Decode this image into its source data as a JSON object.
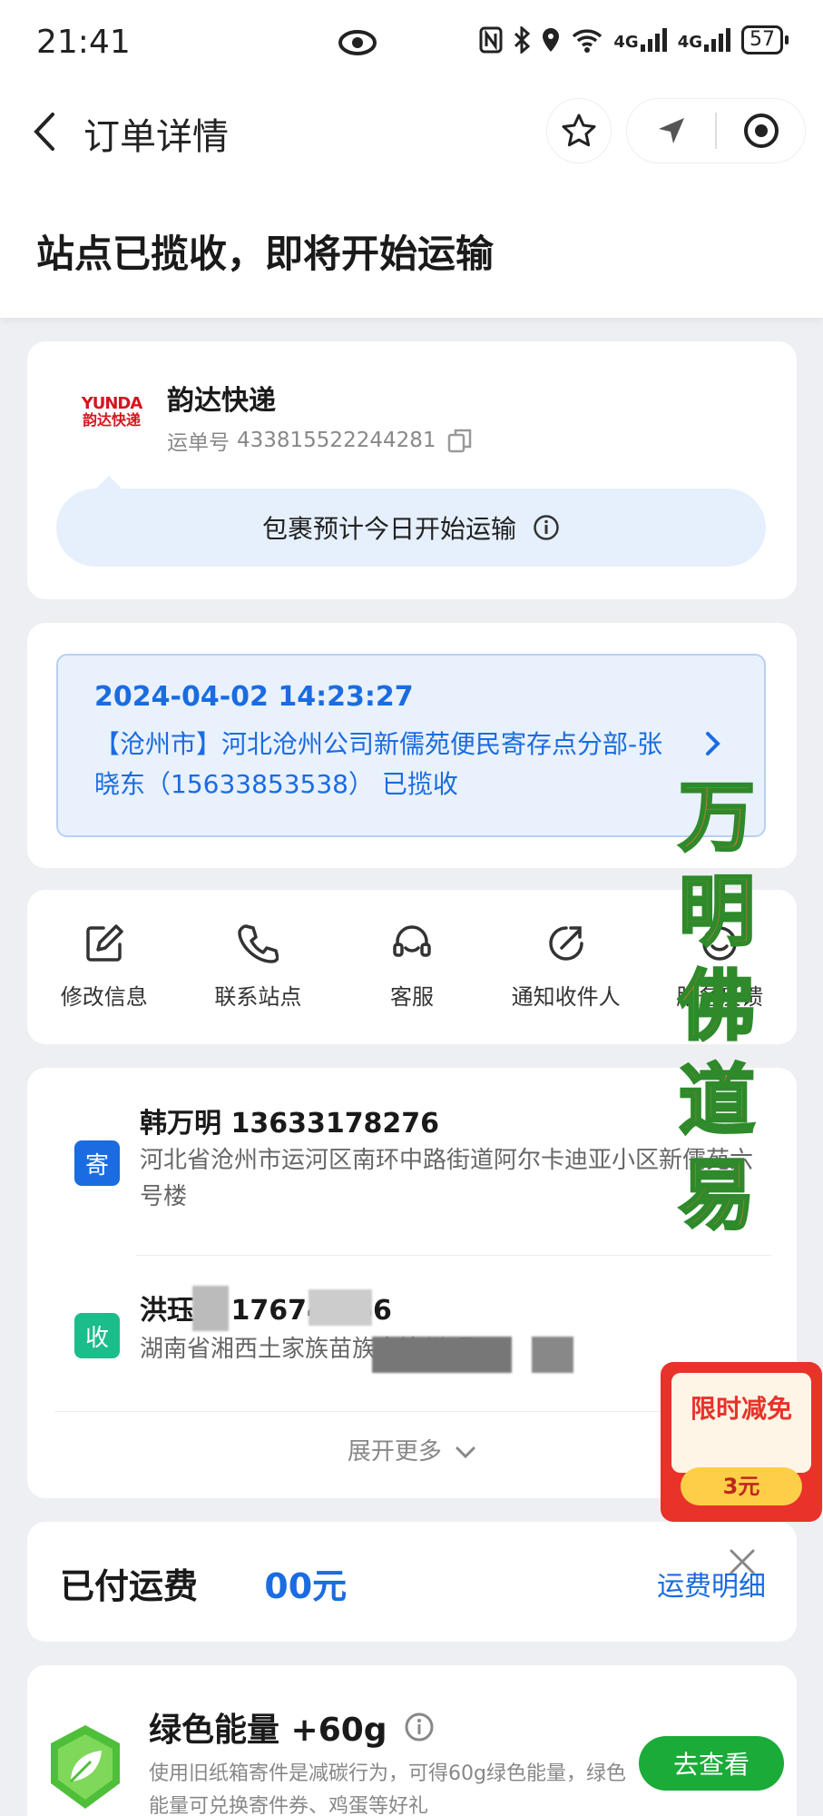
{
  "status_bar": {
    "time": "21:41",
    "network_left": "4G",
    "network_right": "4G",
    "battery": "57"
  },
  "nav": {
    "title": "订单详情"
  },
  "headline": "站点已揽收，即将开始运输",
  "courier": {
    "logo_en": "YUNDA",
    "logo_cn": "韵达快递",
    "name": "韵达快递",
    "waybill_label": "运单号",
    "waybill_number": "433815522244281",
    "eta_notice": "包裹预计今日开始运输"
  },
  "tracking": {
    "datetime": "2024-04-02 14:23:27",
    "description": "【沧州市】河北沧州公司新儒苑便民寄存点分部-张晓东（15633853538） 已揽收"
  },
  "actions": [
    {
      "label": "修改信息",
      "icon": "edit-icon"
    },
    {
      "label": "联系站点",
      "icon": "phone-icon"
    },
    {
      "label": "客服",
      "icon": "headset-icon"
    },
    {
      "label": "通知收件人",
      "icon": "share-icon"
    },
    {
      "label": "服务反馈",
      "icon": "feedback-icon"
    }
  ],
  "sender": {
    "badge": "寄",
    "name_phone": "韩万明 13633178276",
    "address": "河北省沧州市运河区南环中路街道阿尔卡迪亚小区新儒苑六号楼"
  },
  "receiver": {
    "badge": "收",
    "name_phone": "洪珏俊 176743  66",
    "address": "湖南省湘西土家族苗族自治州         县    "
  },
  "expand_more": "展开更多",
  "payment": {
    "label": "已付运费",
    "amount": "00元",
    "detail_link": "运费明细"
  },
  "green_energy": {
    "title": "绿色能量 +60g",
    "description": "使用旧纸箱寄件是减碳行为，可得60g绿色能量，绿色能量可兑换寄件券、鸡蛋等好礼",
    "button": "去查看"
  },
  "watermark": [
    "万",
    "明",
    "佛",
    "道",
    "易"
  ],
  "promo": {
    "title": "限时减免",
    "value": "3元"
  },
  "colors": {
    "accent": "#1a6ce0",
    "green": "#1bab38",
    "brand_red": "#d6141d"
  }
}
